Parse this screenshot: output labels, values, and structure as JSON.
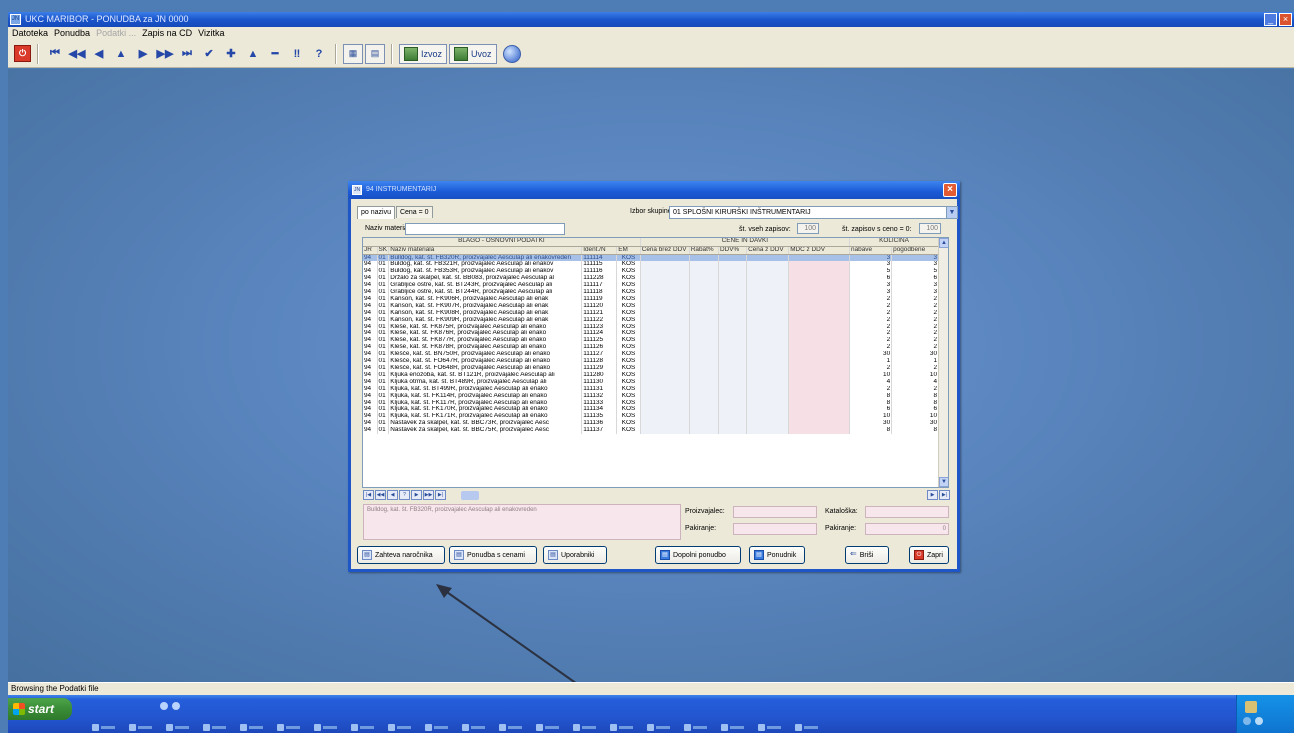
{
  "app": {
    "title": "UKC MARIBOR - PONUDBA za JN 0000",
    "menu": [
      {
        "label": "Datoteka",
        "disabled": false
      },
      {
        "label": "Ponudba",
        "disabled": false
      },
      {
        "label": "Podatki ...",
        "disabled": true
      },
      {
        "label": "Zapis na CD",
        "disabled": false
      },
      {
        "label": "Vizitka",
        "disabled": false
      }
    ],
    "toolbar": {
      "izvoz_label": "Izvoz",
      "uvoz_label": "Uvoz"
    },
    "status": "Browsing the Podatki file"
  },
  "dialog": {
    "title": "94 INSTRUMENTARIJ",
    "tabs": [
      "po nazivu",
      "Cena = 0"
    ],
    "group_label": "Izbor skupine:",
    "group_value": "01 SPLOŠNI KIRURŠKI INŠTRUMENTARIJ",
    "name_label": "Naziv materiala",
    "name_value": "",
    "count_all_label": "št. vseh zapisov:",
    "count_all": "100",
    "count_zero_label": "št. zapisov s ceno = 0:",
    "count_zero": "100",
    "group_headers": {
      "blago": "BLAGO - OSNOVNI PODATKI",
      "cene": "CENE IN DAVKI",
      "kolicina": "KOLIČINA"
    },
    "columns": [
      "JR",
      "SK",
      "Naziv materiala",
      "Ident./N",
      "EM",
      "Cena brez DDV",
      "Rabat%",
      "DDV%",
      "Cena z DDV",
      "MDC z DDV",
      "nabave",
      "pogodbene"
    ],
    "rows": [
      {
        "jr": "94",
        "sk": "01",
        "naziv": "Bulldog, kat. št. FB320R, proizvajalec Aesculap ali enakovreden",
        "ident": "111114",
        "em": "KOS",
        "nabave": "3",
        "pogodbene": "3"
      },
      {
        "jr": "94",
        "sk": "01",
        "naziv": "Buldog, kat. št. FB321R, proizvajalec Aesculap ali enakov",
        "ident": "111115",
        "em": "KOS",
        "nabave": "3",
        "pogodbene": "3"
      },
      {
        "jr": "94",
        "sk": "01",
        "naziv": "Buldog, kat. št. FB353R, proizvajalec Aesculap ali enakov",
        "ident": "111116",
        "em": "KOS",
        "nabave": "5",
        "pogodbene": "5"
      },
      {
        "jr": "94",
        "sk": "01",
        "naziv": "Držalo za skalpel, kat. št. BB083, proizvajalec Aesculap al",
        "ident": "111228",
        "em": "KOS",
        "nabave": "6",
        "pogodbene": "6"
      },
      {
        "jr": "94",
        "sk": "01",
        "naziv": "Grabljice ostre, kat. št. BT243R, proizvajalec Aesculap ali",
        "ident": "111117",
        "em": "KOS",
        "nabave": "3",
        "pogodbene": "3"
      },
      {
        "jr": "94",
        "sk": "01",
        "naziv": "Grabljice ostre, kat. št. BT244R, proizvajalec Aesculap ali",
        "ident": "111118",
        "em": "KOS",
        "nabave": "3",
        "pogodbene": "3"
      },
      {
        "jr": "94",
        "sk": "01",
        "naziv": "Kanson, kat. št. FK906R, proizvajalec Aesculap ali enak",
        "ident": "111119",
        "em": "KOS",
        "nabave": "2",
        "pogodbene": "2"
      },
      {
        "jr": "94",
        "sk": "01",
        "naziv": "Kanson, kat. št. FK907R, proizvajalec Aesculap ali enak",
        "ident": "111120",
        "em": "KOS",
        "nabave": "2",
        "pogodbene": "2"
      },
      {
        "jr": "94",
        "sk": "01",
        "naziv": "Kanson, kat. št. FK908R, proizvajalec Aesculap ali enak",
        "ident": "111121",
        "em": "KOS",
        "nabave": "2",
        "pogodbene": "2"
      },
      {
        "jr": "94",
        "sk": "01",
        "naziv": "Kanson, kat. št. FK909R, proizvajalec Aesculap ali enak",
        "ident": "111122",
        "em": "KOS",
        "nabave": "2",
        "pogodbene": "2"
      },
      {
        "jr": "94",
        "sk": "01",
        "naziv": "Kleše, kat. št. FK875R, proizvajalec Aesculap ali enako",
        "ident": "111123",
        "em": "KOS",
        "nabave": "2",
        "pogodbene": "2"
      },
      {
        "jr": "94",
        "sk": "01",
        "naziv": "Kleše, kat. št. FK876R, proizvajalec Aesculap ali enako",
        "ident": "111124",
        "em": "KOS",
        "nabave": "2",
        "pogodbene": "2"
      },
      {
        "jr": "94",
        "sk": "01",
        "naziv": "Kleše, kat. št. FK877R, proizvajalec Aesculap ali enako",
        "ident": "111125",
        "em": "KOS",
        "nabave": "2",
        "pogodbene": "2"
      },
      {
        "jr": "94",
        "sk": "01",
        "naziv": "Kleše, kat. št. FK878R, proizvajalec Aesculap ali enako",
        "ident": "111126",
        "em": "KOS",
        "nabave": "2",
        "pogodbene": "2"
      },
      {
        "jr": "94",
        "sk": "01",
        "naziv": "Klešče, kat. št. BN750R, proizvajalec Aesculap ali enako",
        "ident": "111127",
        "em": "KOS",
        "nabave": "30",
        "pogodbene": "30"
      },
      {
        "jr": "94",
        "sk": "01",
        "naziv": "Klešče, kat. št. FO647R, proizvajalec Aesculap ali enako",
        "ident": "111128",
        "em": "KOS",
        "nabave": "1",
        "pogodbene": "1"
      },
      {
        "jr": "94",
        "sk": "01",
        "naziv": "Klešče, kat. št. FO648R, proizvajalec Aesculap ali enako",
        "ident": "111129",
        "em": "KOS",
        "nabave": "2",
        "pogodbene": "2"
      },
      {
        "jr": "94",
        "sk": "01",
        "naziv": "Kljuka enozoba, kat. št. BT121R, proizvajalec Aesculap ali",
        "ident": "111280",
        "em": "KOS",
        "nabave": "10",
        "pogodbene": "10"
      },
      {
        "jr": "94",
        "sk": "01",
        "naziv": "Kljuka otrma, kat. št. BT489R, proizvajalec Aesculap ali",
        "ident": "111130",
        "em": "KOS",
        "nabave": "4",
        "pogodbene": "4"
      },
      {
        "jr": "94",
        "sk": "01",
        "naziv": "Kljuka, kat. št. BT499R, proizvajalec Aesculap ali enako",
        "ident": "111131",
        "em": "KOS",
        "nabave": "2",
        "pogodbene": "2"
      },
      {
        "jr": "94",
        "sk": "01",
        "naziv": "Kljuka, kat. št. FK114R, proizvajalec Aesculap ali enako",
        "ident": "111132",
        "em": "KOS",
        "nabave": "8",
        "pogodbene": "8"
      },
      {
        "jr": "94",
        "sk": "01",
        "naziv": "Kljuka, kat. št. FK117R, proizvajalec Aesculap ali enako",
        "ident": "111133",
        "em": "KOS",
        "nabave": "8",
        "pogodbene": "8"
      },
      {
        "jr": "94",
        "sk": "01",
        "naziv": "Kljuka, kat. št. FK170R, proizvajalec Aesculap ali enako",
        "ident": "111134",
        "em": "KOS",
        "nabave": "6",
        "pogodbene": "6"
      },
      {
        "jr": "94",
        "sk": "01",
        "naziv": "Kljuka, kat. št. FK171R, proizvajalec Aesculap ali enako",
        "ident": "111135",
        "em": "KOS",
        "nabave": "10",
        "pogodbene": "10"
      },
      {
        "jr": "94",
        "sk": "01",
        "naziv": "Nastavek za skalpel, kat. št. BBC73R, proizvajalec Aesc",
        "ident": "111136",
        "em": "KOS",
        "nabave": "30",
        "pogodbene": "30"
      },
      {
        "jr": "94",
        "sk": "01",
        "naziv": "Nastavek za skalpel, kat. št. BBC75R, proizvajalec Aesc",
        "ident": "111137",
        "em": "KOS",
        "nabave": "8",
        "pogodbene": "8"
      }
    ],
    "selected_description": "Bulldog, kat. št. FB320R, proizvajalec Aesculap ali enakovreden",
    "labels": {
      "proizvajalec": "Proizvajalec:",
      "pakiranje_lbl": "Pakiranje:",
      "katalog": "Kataloška:",
      "pakiranje": "Pakiranje:"
    },
    "pakiranje_value": "0",
    "buttons": {
      "zahteva": "Zahteva naročnika",
      "ponudba_cenami": "Ponudba s cenami",
      "uporabniki": "Uporabniki",
      "dopolni": "Dopolni ponudbo",
      "ponudnik": "Ponudnik",
      "brisi": "Briši",
      "zapri": "Zapri"
    }
  },
  "taskbar": {
    "start_label": "start"
  }
}
